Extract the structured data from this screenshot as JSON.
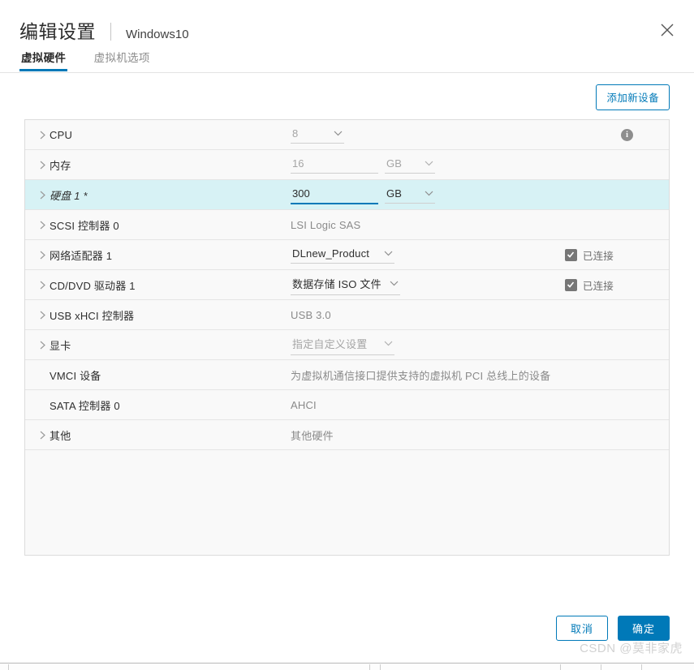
{
  "header": {
    "title": "编辑设置",
    "subtitle": "Windows10",
    "close_icon": "close-icon"
  },
  "tabs": [
    {
      "label": "虚拟硬件",
      "active": true
    },
    {
      "label": "虚拟机选项",
      "active": false
    }
  ],
  "toolbar": {
    "add_device_label": "添加新设备"
  },
  "rows": [
    {
      "label": "CPU",
      "value": "8",
      "unit": "",
      "has_chevron": true,
      "info_icon": "info-icon"
    },
    {
      "label": "内存",
      "value": "16",
      "unit": "GB",
      "has_chevron": true
    },
    {
      "label": "硬盘 1 *",
      "value": "300",
      "unit": "GB",
      "has_chevron": true,
      "highlight": true
    },
    {
      "label": "SCSI 控制器 0",
      "value": "LSI Logic SAS",
      "has_chevron": true
    },
    {
      "label": "网络适配器 1",
      "value": "DLnew_Product",
      "has_chevron": true,
      "checkbox": {
        "label": "已连接",
        "checked": true
      }
    },
    {
      "label": "CD/DVD 驱动器 1",
      "value": "数据存储 ISO 文件",
      "has_chevron": true,
      "checkbox": {
        "label": "已连接",
        "checked": true
      }
    },
    {
      "label": "USB xHCI 控制器",
      "value": "USB 3.0",
      "has_chevron": true
    },
    {
      "label": "显卡",
      "value": "指定自定义设置",
      "has_chevron": true
    },
    {
      "label": "VMCI 设备",
      "value": "为虚拟机通信接口提供支持的虚拟机 PCI 总线上的设备",
      "has_chevron": false
    },
    {
      "label": "SATA 控制器 0",
      "value": "AHCI",
      "has_chevron": false
    },
    {
      "label": "其他",
      "value": "其他硬件",
      "has_chevron": true
    }
  ],
  "footer": {
    "cancel_label": "取消",
    "ok_label": "确定"
  },
  "watermark": "CSDN @莫非家虎",
  "colors": {
    "accent": "#0079b8",
    "highlight_row": "#d7f2f5",
    "row_bg": "#f9f9f9",
    "border": "#dcdcdc"
  }
}
